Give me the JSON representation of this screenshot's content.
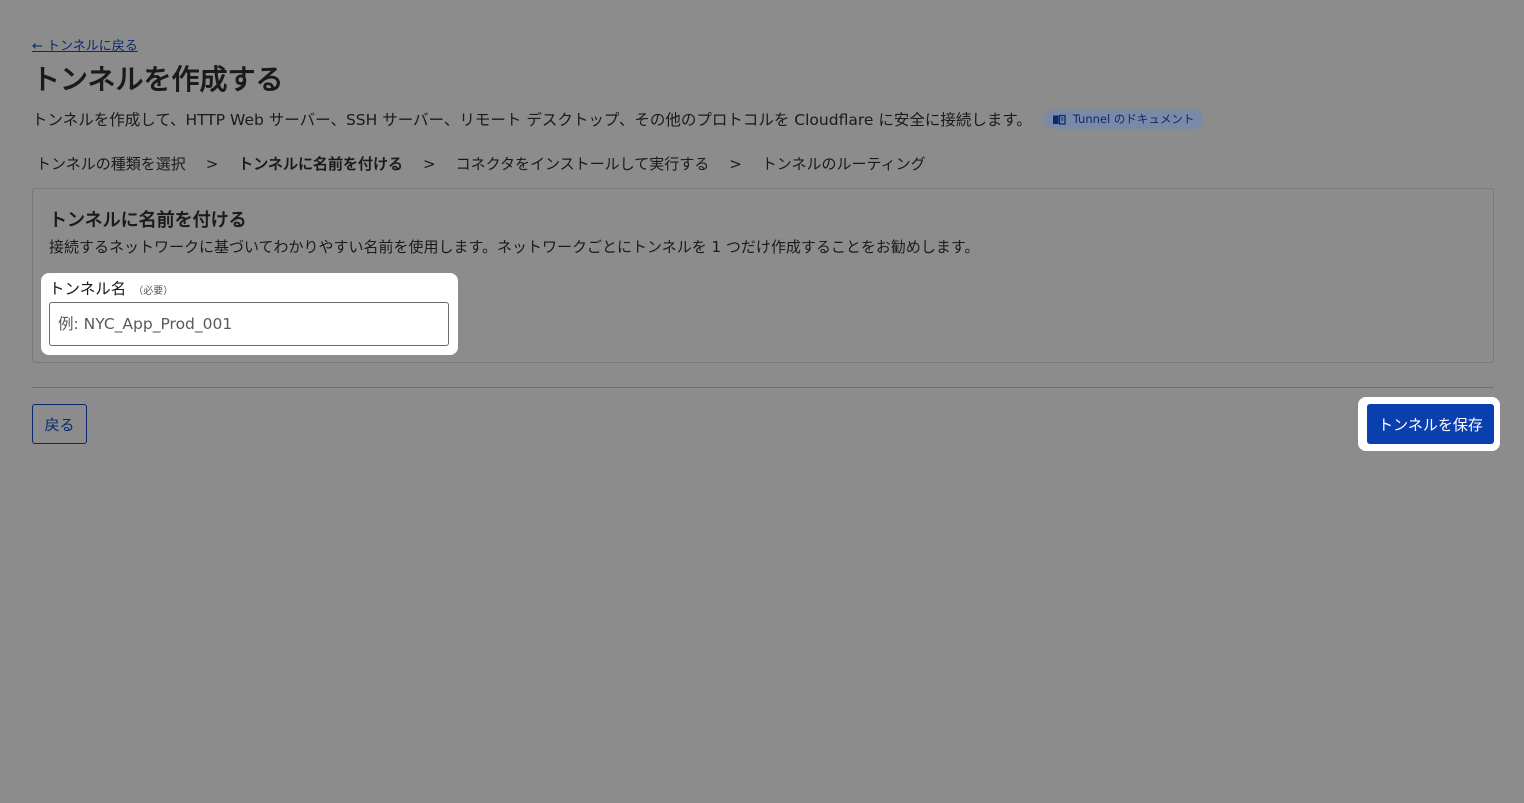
{
  "nav": {
    "back_link": "← トンネルに戻る"
  },
  "header": {
    "title": "トンネルを作成する",
    "description": "トンネルを作成して、HTTP Web サーバー、SSH サーバー、リモート デスクトップ、その他のプロトコルを Cloudflare に安全に接続します。",
    "doc_badge": {
      "label": "Tunnel のドキュメント",
      "icon": "book-icon"
    }
  },
  "steps": {
    "items": [
      {
        "label": "トンネルの種類を選択"
      },
      {
        "label": "トンネルに名前を付ける"
      },
      {
        "label": "コネクタをインストールして実行する"
      },
      {
        "label": "トンネルのルーティング"
      }
    ],
    "separator": ">",
    "current_index": 1
  },
  "card": {
    "title": "トンネルに名前を付ける",
    "description": "接続するネットワークに基づいてわかりやすい名前を使用します。ネットワークごとにトンネルを 1 つだけ作成することをお勧めします。",
    "field": {
      "label": "トンネル名",
      "required": "（必要）",
      "placeholder": "例: NYC_App_Prod_001",
      "value": ""
    }
  },
  "footer": {
    "back_label": "戻る",
    "save_label": "トンネルを保存"
  },
  "colors": {
    "overlay_background": "#8c8c8c",
    "primary": "#0a3fb0",
    "link": "#0a2a6e",
    "highlight": "#ffffff"
  }
}
